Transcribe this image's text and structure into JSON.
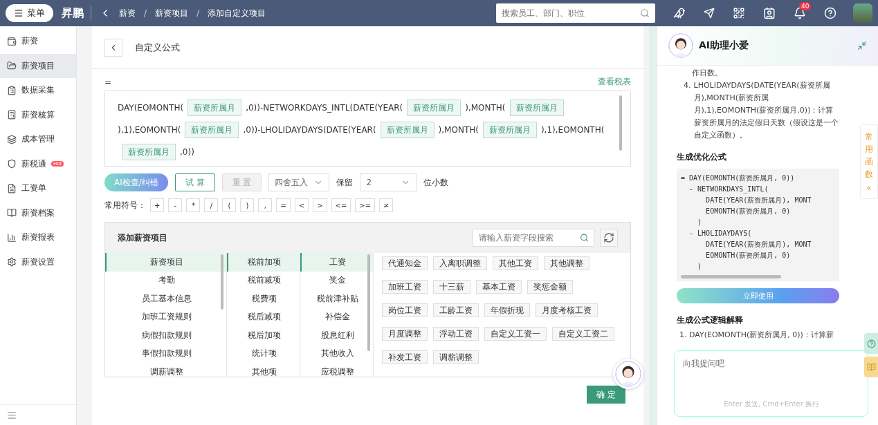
{
  "topbar": {
    "menu_label": "菜单",
    "logo": "昇鹏",
    "breadcrumb": [
      "薪资",
      "薪资项目",
      "添加自定义项目"
    ],
    "breadcrumb_separator": "/",
    "search": {
      "placeholder": "搜索员工、部门、职位"
    },
    "notification_count": "40"
  },
  "sidebar": {
    "items": [
      {
        "label": "薪资",
        "selected": false
      },
      {
        "label": "薪资项目",
        "selected": true
      },
      {
        "label": "数据采集",
        "selected": false
      },
      {
        "label": "薪资核算",
        "selected": false
      },
      {
        "label": "成本管理",
        "selected": false
      },
      {
        "label": "薪税通",
        "selected": false,
        "badge": "Hot"
      },
      {
        "label": "工资单",
        "selected": false
      },
      {
        "label": "薪资档案",
        "selected": false
      },
      {
        "label": "薪资报表",
        "selected": false
      },
      {
        "label": "薪资设置",
        "selected": false
      }
    ]
  },
  "page": {
    "title": "自定义公式",
    "equals": "=",
    "tax_link": "查看税表",
    "formula": [
      {
        "kind": "text",
        "text": "DAY(EOMONTH("
      },
      {
        "kind": "field",
        "text": "薪资所属月"
      },
      {
        "kind": "text",
        "text": ",0))-NETWORKDAYS_INTL(DATE(YEAR("
      },
      {
        "kind": "field",
        "text": "薪资所属月"
      },
      {
        "kind": "text",
        "text": "),MONTH("
      },
      {
        "kind": "field",
        "text": "薪资所属月"
      },
      {
        "kind": "text",
        "text": "),1),EOMONTH("
      },
      {
        "kind": "field",
        "text": "薪资所属月"
      },
      {
        "kind": "text",
        "text": ",0))-LHOLIDAYDAYS(DATE(YEAR("
      },
      {
        "kind": "field",
        "text": "薪资所属月"
      },
      {
        "kind": "text",
        "text": "),MONTH("
      },
      {
        "kind": "field",
        "text": "薪资所属月"
      },
      {
        "kind": "text",
        "text": "),1),EOMONTH("
      },
      {
        "kind": "field",
        "text": "薪资所属月"
      },
      {
        "kind": "text",
        "text": ",0))"
      }
    ],
    "actions": [
      {
        "label": "AI检查/纠错",
        "kind": "ai",
        "disabled": false
      },
      {
        "label": "试 算",
        "kind": "outline",
        "disabled": false
      },
      {
        "label": "重 置",
        "kind": "plain",
        "disabled": true
      }
    ],
    "rounding": {
      "value": "四舍五入"
    },
    "keep_label": "保留",
    "decimals": {
      "value": "2"
    },
    "decimals_suffix": "位小数",
    "symbols_label": "常用符号：",
    "symbols": [
      "+",
      "-",
      "*",
      "/",
      "(",
      ")",
      ",",
      "=",
      "<",
      ">",
      "<=",
      ">=",
      "≠"
    ],
    "picker": {
      "title": "添加薪资项目",
      "search": {
        "placeholder": "请输入薪资字段搜索"
      },
      "column_1": [
        {
          "label": "薪资项目",
          "selected": true
        },
        {
          "label": "考勤",
          "selected": false
        },
        {
          "label": "员工基本信息",
          "selected": false
        },
        {
          "label": "加班工资规则",
          "selected": false
        },
        {
          "label": "病假扣款规则",
          "selected": false
        },
        {
          "label": "事假扣款规则",
          "selected": false
        },
        {
          "label": "调薪调整",
          "selected": false
        }
      ],
      "column_2": [
        {
          "label": "税前加项",
          "selected": true
        },
        {
          "label": "税前减项",
          "selected": false
        },
        {
          "label": "税费项",
          "selected": false
        },
        {
          "label": "税后减项",
          "selected": false
        },
        {
          "label": "税后加项",
          "selected": false
        },
        {
          "label": "统计项",
          "selected": false
        },
        {
          "label": "其他项",
          "selected": false
        }
      ],
      "column_3": [
        {
          "label": "工资",
          "selected": true
        },
        {
          "label": "奖金",
          "selected": false
        },
        {
          "label": "税前津补贴",
          "selected": false
        },
        {
          "label": "补偿金",
          "selected": false
        },
        {
          "label": "股息红利",
          "selected": false
        },
        {
          "label": "其他收入",
          "selected": false
        },
        {
          "label": "应税调整",
          "selected": false
        }
      ],
      "tags": [
        "代通知金",
        "入离职调整",
        "其他工资",
        "其他调整",
        "加班工资",
        "十三薪",
        "基本工资",
        "奖惩金额",
        "岗位工资",
        "工龄工资",
        "年假折现",
        "月度考核工资",
        "月度调整",
        "浮动工资",
        "自定义工资一",
        "自定义工资二",
        "补发工资",
        "调薪调整"
      ]
    },
    "confirm": "确 定"
  },
  "assistant": {
    "title": "AI助理小爱",
    "continued": "作日数。",
    "item": {
      "number": "4.",
      "text": "LHOLIDAYDAYS(DATE(YEAR(薪资所属月),MONTH(薪资所属月),1),EOMONTH(薪资所属月,0))：计算薪资所属月的法定假日天数（假设这是一个自定义函数）。"
    },
    "optimized_heading": "生成优化公式",
    "code": [
      "= DAY(EOMONTH(薪资所属月, 0))",
      "  - NETWORKDAYS_INTL(",
      "      DATE(YEAR(薪资所属月), MONT",
      "      EOMONTH(薪资所属月, 0)",
      "    )",
      "  - LHOLIDAYDAYS(",
      "      DATE(YEAR(薪资所属月), MONT",
      "      EOMONTH(薪资所属月, 0)",
      "    )"
    ],
    "use_button": "立即使用",
    "logic_heading": "生成公式逻辑解释",
    "logic_first": "1. DAY(EOMONTH(薪资所属月, 0))：计算薪",
    "input": {
      "placeholder": "向我提问吧",
      "hint": "Enter 发送, Cmd+Enter 换行"
    },
    "side_tab": {
      "label": "常用函数",
      "arrow": "«"
    }
  }
}
